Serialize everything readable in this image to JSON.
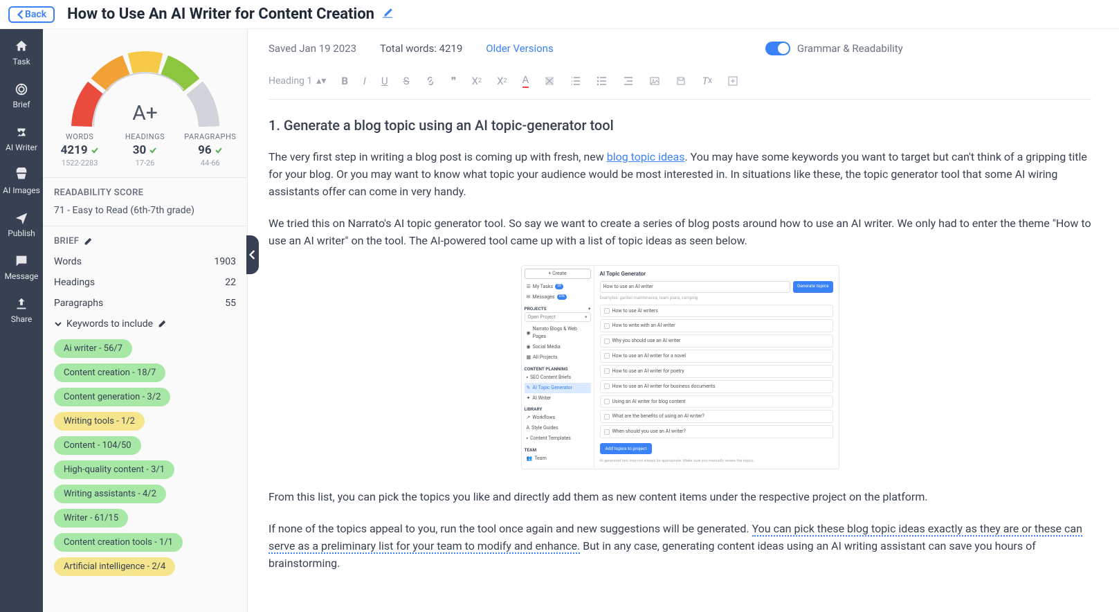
{
  "topbar": {
    "back": "Back",
    "title": "How to Use An AI Writer for Content Creation"
  },
  "rail": [
    {
      "label": "Task"
    },
    {
      "label": "Brief"
    },
    {
      "label": "AI Writer"
    },
    {
      "label": "AI Images"
    },
    {
      "label": "Publish"
    },
    {
      "label": "Message"
    },
    {
      "label": "Share"
    }
  ],
  "score": {
    "grade": "A+",
    "metrics": {
      "words": {
        "label": "WORDS",
        "value": "4219",
        "range": "1522-2283"
      },
      "headings": {
        "label": "HEADINGS",
        "value": "30",
        "range": "17-26"
      },
      "paragraphs": {
        "label": "PARAGRAPHS",
        "value": "96",
        "range": "44-66"
      }
    }
  },
  "readability": {
    "title": "READABILITY SCORE",
    "text": "71 - Easy to Read (6th-7th grade)"
  },
  "brief": {
    "title": "BRIEF",
    "rows": {
      "words": {
        "label": "Words",
        "value": "1903"
      },
      "headings": {
        "label": "Headings",
        "value": "22"
      },
      "paragraphs": {
        "label": "Paragraphs",
        "value": "55"
      }
    },
    "keywords_title": "Keywords to include",
    "keywords": [
      {
        "text": "Ai writer - 56/7",
        "cls": "kw-green"
      },
      {
        "text": "Content creation - 18/7",
        "cls": "kw-green"
      },
      {
        "text": "Content generation - 3/2",
        "cls": "kw-green"
      },
      {
        "text": "Writing tools - 1/2",
        "cls": "kw-yellow"
      },
      {
        "text": "Content - 104/50",
        "cls": "kw-green"
      },
      {
        "text": "High-quality content - 3/1",
        "cls": "kw-green"
      },
      {
        "text": "Writing assistants - 4/2",
        "cls": "kw-green"
      },
      {
        "text": "Writer - 61/15",
        "cls": "kw-green"
      },
      {
        "text": "Content creation tools - 1/1",
        "cls": "kw-green"
      },
      {
        "text": "Artificial intelligence - 2/4",
        "cls": "kw-yellow"
      }
    ]
  },
  "editor": {
    "saved": "Saved Jan 19 2023",
    "total": "Total words: 4219",
    "older": "Older Versions",
    "toggle_label": "Grammar & Readability",
    "heading_sel": "Heading 1"
  },
  "content": {
    "h2": "1. Generate a blog topic using an AI topic-generator tool",
    "p1a": "The very first step in writing a blog post is coming up with fresh, new ",
    "p1link": "blog topic ideas",
    "p1b": ". You may have some keywords you want to target but can't think of a gripping title for your blog. Or you may want to know what topic your audience would be most interested in. In situations like these, the topic generator tool that some AI wiring assistants offer can come in very handy.",
    "p2": "We tried this on Narrato's AI topic generator tool. So say we want to create a series of blog posts around how to use an AI writer. We only had to enter the theme \"How to use an AI writer\" on the tool. The AI-powered tool came up with a list of topic ideas as seen below.",
    "p3": "From this list, you can pick the topics you like and directly add them as new content items under the respective project on the platform.",
    "p4a": "If none of the topics appeal to you, run the tool once again and new suggestions will be generated. ",
    "p4u": "You can pick these blog topic ideas exactly as they are or these can serve as a preliminary list for your team to modify and enhance.",
    "p4b": " But in any case, generating content ideas using an AI writing assistant can save you hours of brainstorming."
  },
  "embed": {
    "title": "AI Topic Generator",
    "create": "+ Create",
    "search_value": "How to use an AI writer",
    "gen_btn": "Generate topics",
    "hint": "Examples: garden maintenance, team plans, camping",
    "side": {
      "mytasks": "My Tasks",
      "mytasks_badge": "20",
      "messages": "Messages",
      "messages_badge": "236",
      "projects": "PROJECTS",
      "open_project": "Open Project",
      "narrato": "Narrato Blogs & Web Pages",
      "social": "Social Media",
      "all": "All Projects",
      "planning": "CONTENT PLANNING",
      "seo": "SEO Content Briefs",
      "topic_gen": "AI Topic Generator",
      "ai_writer": "AI Writer",
      "library": "LIBRARY",
      "workflows": "Workflows",
      "style": "Style Guides",
      "templates": "Content Templates",
      "team": "TEAM",
      "team_item": "Team"
    },
    "results": [
      "How to use AI writers",
      "How to write with an AI writer",
      "Why you should use an AI writer",
      "How to use an AI writer for a novel",
      "How to use an AI writer for poetry",
      "How to use an AI writer for business documents",
      "Using an AI writer for blog content",
      "What are the benefits of using an AI writer?",
      "When should you use an AI writer?"
    ],
    "add_btn": "Add topics to project",
    "disclaimer": "AI generated text may not always be appropriate. Make sure you manually review the topics."
  }
}
